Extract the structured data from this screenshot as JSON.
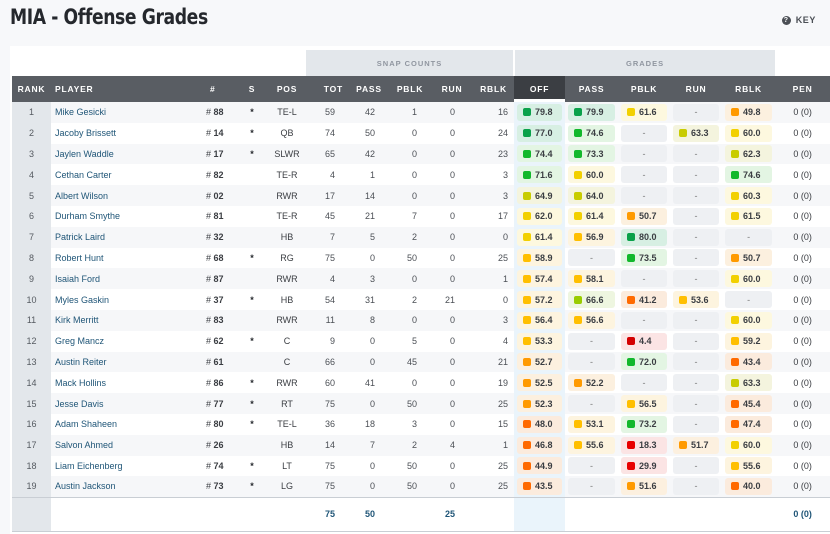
{
  "header": {
    "title": "MIA - Offense Grades",
    "key_label": "KEY",
    "key_icon": "question-circle-icon"
  },
  "table": {
    "groups": {
      "snap_counts": "SNAP COUNTS",
      "grades": "GRADES"
    },
    "columns": {
      "rank": "RANK",
      "player": "PLAYER",
      "jersey": "#",
      "starter": "S",
      "pos": "POS",
      "tot": "TOT",
      "snap_pass": "PASS",
      "snap_pblk": "PBLK",
      "snap_run": "RUN",
      "snap_rblk": "RBLK",
      "off": "OFF",
      "g_pass": "PASS",
      "g_pblk": "PBLK",
      "g_run": "RUN",
      "g_rblk": "RBLK",
      "pen": "PEN"
    },
    "sorted_column": "OFF",
    "starter_glyph": "*",
    "empty_grade": "-",
    "grade_colors": {
      "dark_green": "#0aa14a",
      "green": "#12b82c",
      "lime": "#99cc00",
      "olive": "#c8cc00",
      "yellow": "#f2d000",
      "amber": "#ffbf00",
      "orange": "#ff9a00",
      "dark_orange": "#ff6a00",
      "red": "#e80000",
      "dark_red": "#d40000"
    },
    "rows": [
      {
        "rank": "1",
        "player": "Mike Gesicki",
        "jersey": "88",
        "starter": true,
        "pos": "TE-L",
        "tot": "59",
        "pass": "42",
        "pblk": "1",
        "run": "0",
        "rblk": "16",
        "off": "79.8",
        "g_pass": "79.9",
        "g_pblk": "61.6",
        "g_run": null,
        "g_rblk": "49.8",
        "pen": "0 (0)"
      },
      {
        "rank": "2",
        "player": "Jacoby Brissett",
        "jersey": "14",
        "starter": true,
        "pos": "QB",
        "tot": "74",
        "pass": "50",
        "pblk": "0",
        "run": "0",
        "rblk": "24",
        "off": "77.0",
        "g_pass": "74.6",
        "g_pblk": null,
        "g_run": "63.3",
        "g_rblk": "60.0",
        "pen": "0 (0)"
      },
      {
        "rank": "3",
        "player": "Jaylen Waddle",
        "jersey": "17",
        "starter": true,
        "pos": "SLWR",
        "tot": "65",
        "pass": "42",
        "pblk": "0",
        "run": "0",
        "rblk": "23",
        "off": "74.4",
        "g_pass": "73.3",
        "g_pblk": null,
        "g_run": null,
        "g_rblk": "62.3",
        "pen": "0 (0)"
      },
      {
        "rank": "4",
        "player": "Cethan Carter",
        "jersey": "82",
        "starter": false,
        "pos": "TE-R",
        "tot": "4",
        "pass": "1",
        "pblk": "0",
        "run": "0",
        "rblk": "3",
        "off": "71.6",
        "g_pass": "60.0",
        "g_pblk": null,
        "g_run": null,
        "g_rblk": "74.6",
        "pen": "0 (0)"
      },
      {
        "rank": "5",
        "player": "Albert Wilson",
        "jersey": "02",
        "starter": false,
        "pos": "RWR",
        "tot": "17",
        "pass": "14",
        "pblk": "0",
        "run": "0",
        "rblk": "3",
        "off": "64.9",
        "g_pass": "64.0",
        "g_pblk": null,
        "g_run": null,
        "g_rblk": "60.3",
        "pen": "0 (0)"
      },
      {
        "rank": "6",
        "player": "Durham Smythe",
        "jersey": "81",
        "starter": false,
        "pos": "TE-R",
        "tot": "45",
        "pass": "21",
        "pblk": "7",
        "run": "0",
        "rblk": "17",
        "off": "62.0",
        "g_pass": "61.4",
        "g_pblk": "50.7",
        "g_run": null,
        "g_rblk": "61.5",
        "pen": "0 (0)"
      },
      {
        "rank": "7",
        "player": "Patrick Laird",
        "jersey": "32",
        "starter": false,
        "pos": "HB",
        "tot": "7",
        "pass": "5",
        "pblk": "2",
        "run": "0",
        "rblk": "0",
        "off": "61.4",
        "g_pass": "56.9",
        "g_pblk": "80.0",
        "g_run": null,
        "g_rblk": null,
        "pen": "0 (0)"
      },
      {
        "rank": "8",
        "player": "Robert Hunt",
        "jersey": "68",
        "starter": true,
        "pos": "RG",
        "tot": "75",
        "pass": "0",
        "pblk": "50",
        "run": "0",
        "rblk": "25",
        "off": "58.9",
        "g_pass": null,
        "g_pblk": "73.5",
        "g_run": null,
        "g_rblk": "50.7",
        "pen": "0 (0)"
      },
      {
        "rank": "9",
        "player": "Isaiah Ford",
        "jersey": "87",
        "starter": false,
        "pos": "RWR",
        "tot": "4",
        "pass": "3",
        "pblk": "0",
        "run": "0",
        "rblk": "1",
        "off": "57.4",
        "g_pass": "58.1",
        "g_pblk": null,
        "g_run": null,
        "g_rblk": "60.0",
        "pen": "0 (0)"
      },
      {
        "rank": "10",
        "player": "Myles Gaskin",
        "jersey": "37",
        "starter": true,
        "pos": "HB",
        "tot": "54",
        "pass": "31",
        "pblk": "2",
        "run": "21",
        "rblk": "0",
        "off": "57.2",
        "g_pass": "66.6",
        "g_pblk": "41.2",
        "g_run": "53.6",
        "g_rblk": null,
        "pen": "0 (0)"
      },
      {
        "rank": "11",
        "player": "Kirk Merritt",
        "jersey": "83",
        "starter": false,
        "pos": "RWR",
        "tot": "11",
        "pass": "8",
        "pblk": "0",
        "run": "0",
        "rblk": "3",
        "off": "56.4",
        "g_pass": "56.6",
        "g_pblk": null,
        "g_run": null,
        "g_rblk": "60.0",
        "pen": "0 (0)"
      },
      {
        "rank": "12",
        "player": "Greg Mancz",
        "jersey": "62",
        "starter": true,
        "pos": "C",
        "tot": "9",
        "pass": "0",
        "pblk": "5",
        "run": "0",
        "rblk": "4",
        "off": "53.3",
        "g_pass": null,
        "g_pblk": "4.4",
        "g_run": null,
        "g_rblk": "59.2",
        "pen": "0 (0)"
      },
      {
        "rank": "13",
        "player": "Austin Reiter",
        "jersey": "61",
        "starter": false,
        "pos": "C",
        "tot": "66",
        "pass": "0",
        "pblk": "45",
        "run": "0",
        "rblk": "21",
        "off": "52.7",
        "g_pass": null,
        "g_pblk": "72.0",
        "g_run": null,
        "g_rblk": "43.4",
        "pen": "0 (0)"
      },
      {
        "rank": "14",
        "player": "Mack Hollins",
        "jersey": "86",
        "starter": true,
        "pos": "RWR",
        "tot": "60",
        "pass": "41",
        "pblk": "0",
        "run": "0",
        "rblk": "19",
        "off": "52.5",
        "g_pass": "52.2",
        "g_pblk": null,
        "g_run": null,
        "g_rblk": "63.3",
        "pen": "0 (0)"
      },
      {
        "rank": "15",
        "player": "Jesse Davis",
        "jersey": "77",
        "starter": true,
        "pos": "RT",
        "tot": "75",
        "pass": "0",
        "pblk": "50",
        "run": "0",
        "rblk": "25",
        "off": "52.3",
        "g_pass": null,
        "g_pblk": "56.5",
        "g_run": null,
        "g_rblk": "45.4",
        "pen": "0 (0)"
      },
      {
        "rank": "16",
        "player": "Adam Shaheen",
        "jersey": "80",
        "starter": true,
        "pos": "TE-L",
        "tot": "36",
        "pass": "18",
        "pblk": "3",
        "run": "0",
        "rblk": "15",
        "off": "48.0",
        "g_pass": "53.1",
        "g_pblk": "73.2",
        "g_run": null,
        "g_rblk": "47.4",
        "pen": "0 (0)"
      },
      {
        "rank": "17",
        "player": "Salvon Ahmed",
        "jersey": "26",
        "starter": false,
        "pos": "HB",
        "tot": "14",
        "pass": "7",
        "pblk": "2",
        "run": "4",
        "rblk": "1",
        "off": "46.8",
        "g_pass": "55.6",
        "g_pblk": "18.3",
        "g_run": "51.7",
        "g_rblk": "60.0",
        "pen": "0 (0)"
      },
      {
        "rank": "18",
        "player": "Liam Eichenberg",
        "jersey": "74",
        "starter": true,
        "pos": "LT",
        "tot": "75",
        "pass": "0",
        "pblk": "50",
        "run": "0",
        "rblk": "25",
        "off": "44.9",
        "g_pass": null,
        "g_pblk": "29.9",
        "g_run": null,
        "g_rblk": "55.6",
        "pen": "0 (0)"
      },
      {
        "rank": "19",
        "player": "Austin Jackson",
        "jersey": "73",
        "starter": true,
        "pos": "LG",
        "tot": "75",
        "pass": "0",
        "pblk": "50",
        "run": "0",
        "rblk": "25",
        "off": "43.5",
        "g_pass": null,
        "g_pblk": "51.6",
        "g_run": null,
        "g_rblk": "40.0",
        "pen": "0 (0)"
      }
    ],
    "totals": {
      "tot": "75",
      "pass": "50",
      "pblk": "",
      "run": "25",
      "rblk": "",
      "pen": "0 (0)"
    }
  }
}
